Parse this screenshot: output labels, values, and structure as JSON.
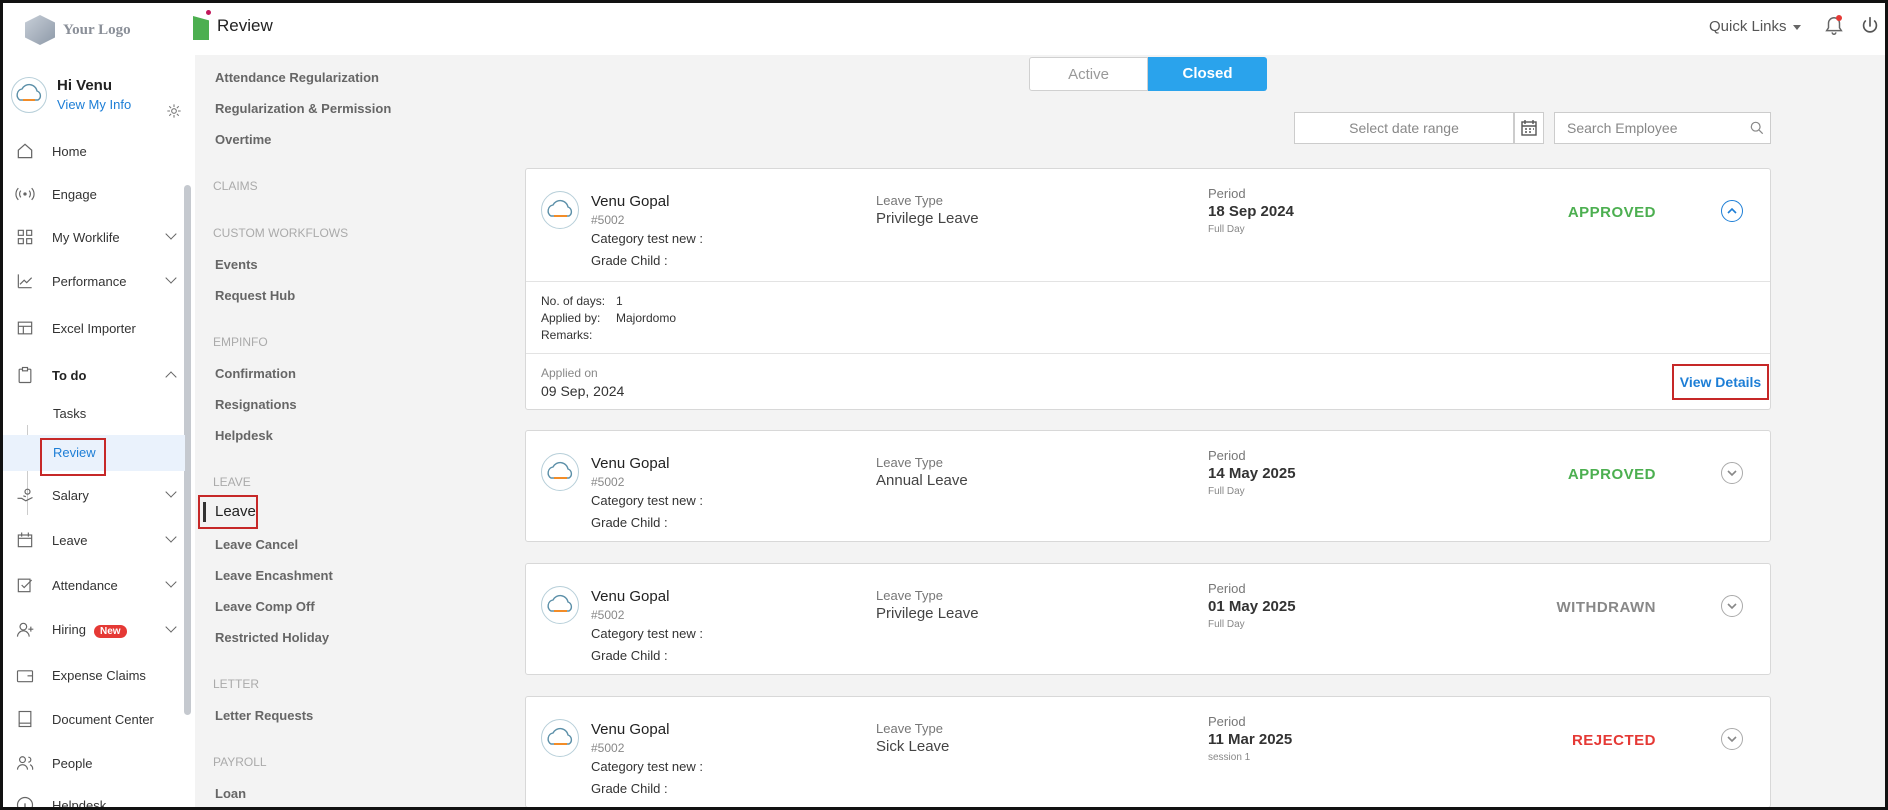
{
  "header": {
    "logo_text": "Your Logo",
    "page_title": "Review",
    "quick_links": "Quick Links"
  },
  "user": {
    "greeting": "Hi Venu",
    "view_info": "View My Info"
  },
  "sidebar": {
    "items": [
      {
        "label": "Home",
        "icon": "home-icon"
      },
      {
        "label": "Engage",
        "icon": "broadcast-icon"
      },
      {
        "label": "My Worklife",
        "icon": "grid-icon"
      },
      {
        "label": "Performance",
        "icon": "chart-line-icon"
      },
      {
        "label": "Excel Importer",
        "icon": "table-icon"
      },
      {
        "label": "To do",
        "icon": "clipboard-icon"
      },
      {
        "label": "Salary",
        "icon": "money-hand-icon"
      },
      {
        "label": "Leave",
        "icon": "calendar-icon"
      },
      {
        "label": "Attendance",
        "icon": "checklist-icon"
      },
      {
        "label": "Hiring",
        "icon": "user-plus-icon",
        "badge": "New"
      },
      {
        "label": "Expense Claims",
        "icon": "wallet-icon"
      },
      {
        "label": "Document Center",
        "icon": "document-icon"
      },
      {
        "label": "People",
        "icon": "people-icon"
      },
      {
        "label": "Helpdesk",
        "icon": "help-icon"
      }
    ],
    "todo_sub": [
      "Tasks",
      "Review"
    ]
  },
  "submenu": {
    "top_items": [
      "Attendance Regularization",
      "Regularization & Permission",
      "Overtime"
    ],
    "claims_head": "CLAIMS",
    "custom_head": "CUSTOM WORKFLOWS",
    "custom_items": [
      "Events",
      "Request Hub"
    ],
    "empinfo_head": "EMPINFO",
    "empinfo_items": [
      "Confirmation",
      "Resignations",
      "Helpdesk"
    ],
    "leave_head": "LEAVE",
    "leave_items": [
      "Leave",
      "Leave Cancel",
      "Leave Encashment",
      "Leave Comp Off",
      "Restricted Holiday"
    ],
    "letter_head": "LETTER",
    "letter_items": [
      "Letter Requests"
    ],
    "payroll_head": "PAYROLL",
    "payroll_items": [
      "Loan"
    ]
  },
  "filters": {
    "tab_active": "Active",
    "tab_closed": "Closed",
    "date_placeholder": "Select date range",
    "search_placeholder": "Search Employee"
  },
  "cards": [
    {
      "name": "Venu Gopal",
      "id": "#5002",
      "category": "Category test new :",
      "grade": "Grade Child :",
      "leave_type_label": "Leave Type",
      "leave_type": "Privilege Leave",
      "period_label": "Period",
      "period": "18 Sep 2024",
      "period_sub": "Full Day",
      "status": "APPROVED",
      "days_label": "No. of days:",
      "days": "1",
      "applied_by_label": "Applied by:",
      "applied_by": "Majordomo",
      "remarks_label": "Remarks:",
      "applied_on_label": "Applied on",
      "applied_on": "09 Sep, 2024",
      "view_details": "View Details"
    },
    {
      "name": "Venu Gopal",
      "id": "#5002",
      "category": "Category test new :",
      "grade": "Grade Child :",
      "leave_type_label": "Leave Type",
      "leave_type": "Annual Leave",
      "period_label": "Period",
      "period": "14 May 2025",
      "period_sub": "Full Day",
      "status": "APPROVED"
    },
    {
      "name": "Venu Gopal",
      "id": "#5002",
      "category": "Category test new :",
      "grade": "Grade Child :",
      "leave_type_label": "Leave Type",
      "leave_type": "Privilege Leave",
      "period_label": "Period",
      "period": "01 May 2025",
      "period_sub": "Full Day",
      "status": "WITHDRAWN"
    },
    {
      "name": "Venu Gopal",
      "id": "#5002",
      "category": "Category test new :",
      "grade": "Grade Child :",
      "leave_type_label": "Leave Type",
      "leave_type": "Sick Leave",
      "period_label": "Period",
      "period": "11 Mar 2025",
      "period_sub": "session 1",
      "status": "REJECTED"
    }
  ],
  "colors": {
    "accent": "#2aa3ec",
    "approved": "#4caf50",
    "rejected": "#e53935",
    "withdrawn": "#888888",
    "highlight_box": "#c62828"
  }
}
